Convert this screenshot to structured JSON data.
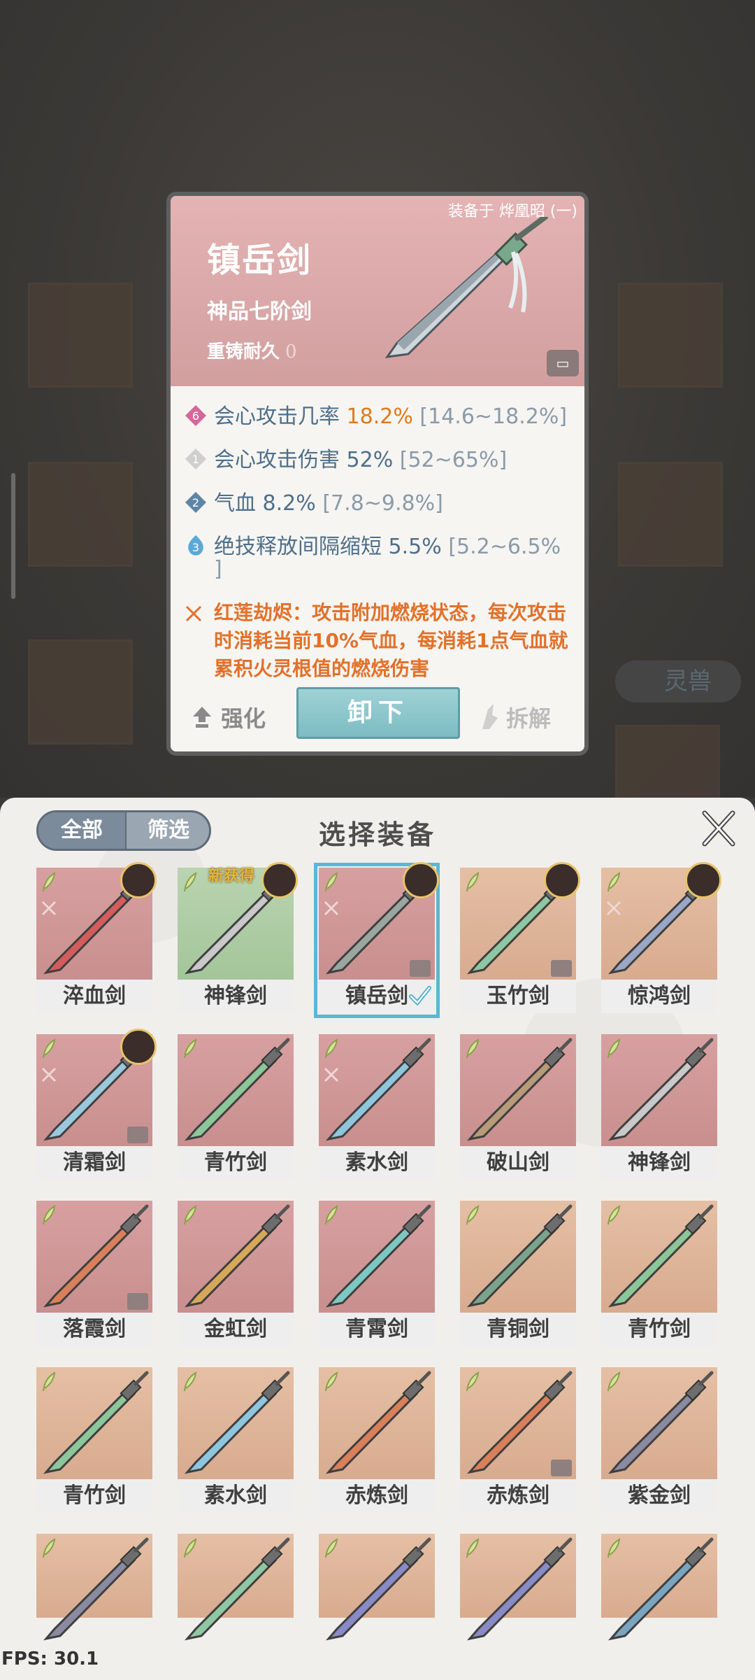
{
  "detail": {
    "equipped_on": "装备于 烨凰昭 (一)",
    "name": "镇岳剑",
    "grade": "神品七阶剑",
    "recast_label": "重铸耐久",
    "recast_value": "0",
    "stats": [
      {
        "badge": "6",
        "badge_color": "#d9669a",
        "label": "会心攻击几率",
        "value": "18.2%",
        "range": "[14.6~18.2%]"
      },
      {
        "badge": "1",
        "badge_color": "#cfcfcf",
        "label": "会心攻击伤害",
        "value": "52%",
        "range": "[52~65%]"
      },
      {
        "badge": "2",
        "badge_color": "#5f85a6",
        "label": "气血",
        "value": "8.2%",
        "range": "[7.8~9.8%]"
      },
      {
        "badge": "3",
        "badge_color": "#5aa9d8",
        "label": "绝技释放间隔缩短",
        "value": "5.5%",
        "range": "[5.2~6.5%"
      }
    ],
    "stat4_wrap": "]",
    "skill_text": "红莲劫烬：攻击附加燃烧状态，每次攻击时消耗当前10%气血，每消耗1点气血就累积火灵根值的燃烧伤害",
    "btn_strengthen": "强化",
    "btn_unequip": "卸下",
    "btn_dismantle": "拆解"
  },
  "background": {
    "chip_label": "灵兽"
  },
  "panel": {
    "seg_all": "全部",
    "seg_filter": "筛选",
    "title": "选择装备",
    "new_tag": "新获得"
  },
  "items": [
    {
      "name": "淬血剑",
      "bg": "red",
      "fire": true,
      "lock": false,
      "avatar": true,
      "new": false,
      "selected": false,
      "blade": "#d45c5c"
    },
    {
      "name": "神锋剑",
      "bg": "green",
      "fire": false,
      "lock": false,
      "avatar": true,
      "new": true,
      "selected": false,
      "blade": "#c9c9c9"
    },
    {
      "name": "镇岳剑",
      "bg": "red",
      "fire": true,
      "lock": true,
      "avatar": true,
      "new": false,
      "selected": true,
      "blade": "#9aa6a0"
    },
    {
      "name": "玉竹剑",
      "bg": "peach",
      "fire": false,
      "lock": true,
      "avatar": true,
      "new": false,
      "selected": false,
      "blade": "#8fc7a2"
    },
    {
      "name": "惊鸿剑",
      "bg": "peach",
      "fire": true,
      "lock": false,
      "avatar": true,
      "new": false,
      "selected": false,
      "blade": "#9aa7c6"
    },
    {
      "name": "清霜剑",
      "bg": "red",
      "fire": true,
      "lock": true,
      "avatar": true,
      "new": false,
      "selected": false,
      "blade": "#9bc8dc"
    },
    {
      "name": "青竹剑",
      "bg": "red",
      "fire": false,
      "lock": false,
      "avatar": false,
      "new": false,
      "selected": false,
      "blade": "#8cc79a"
    },
    {
      "name": "素水剑",
      "bg": "red",
      "fire": true,
      "lock": false,
      "avatar": false,
      "new": false,
      "selected": false,
      "blade": "#8fc6de"
    },
    {
      "name": "破山剑",
      "bg": "red",
      "fire": false,
      "lock": false,
      "avatar": false,
      "new": false,
      "selected": false,
      "blade": "#b79a78"
    },
    {
      "name": "神锋剑",
      "bg": "red",
      "fire": false,
      "lock": false,
      "avatar": false,
      "new": false,
      "selected": false,
      "blade": "#c9c9c9"
    },
    {
      "name": "落霞剑",
      "bg": "red",
      "fire": false,
      "lock": true,
      "avatar": false,
      "new": false,
      "selected": false,
      "blade": "#d9805a"
    },
    {
      "name": "金虹剑",
      "bg": "red",
      "fire": false,
      "lock": false,
      "avatar": false,
      "new": false,
      "selected": false,
      "blade": "#d6a85a"
    },
    {
      "name": "青霄剑",
      "bg": "red",
      "fire": false,
      "lock": false,
      "avatar": false,
      "new": false,
      "selected": false,
      "blade": "#7ec8c2"
    },
    {
      "name": "青铜剑",
      "bg": "peach",
      "fire": false,
      "lock": false,
      "avatar": false,
      "new": false,
      "selected": false,
      "blade": "#7aa58c"
    },
    {
      "name": "青竹剑",
      "bg": "peach",
      "fire": false,
      "lock": false,
      "avatar": false,
      "new": false,
      "selected": false,
      "blade": "#8cc79a"
    },
    {
      "name": "青竹剑",
      "bg": "peach",
      "fire": false,
      "lock": false,
      "avatar": false,
      "new": false,
      "selected": false,
      "blade": "#8cc79a"
    },
    {
      "name": "素水剑",
      "bg": "peach",
      "fire": false,
      "lock": false,
      "avatar": false,
      "new": false,
      "selected": false,
      "blade": "#8fc6de"
    },
    {
      "name": "赤炼剑",
      "bg": "peach",
      "fire": false,
      "lock": false,
      "avatar": false,
      "new": false,
      "selected": false,
      "blade": "#d9805a"
    },
    {
      "name": "赤炼剑",
      "bg": "peach",
      "fire": false,
      "lock": true,
      "avatar": false,
      "new": false,
      "selected": false,
      "blade": "#d9805a"
    },
    {
      "name": "紫金剑",
      "bg": "peach",
      "fire": false,
      "lock": false,
      "avatar": false,
      "new": false,
      "selected": false,
      "blade": "#8a8aa0"
    },
    {
      "name": "",
      "bg": "peach",
      "fire": false,
      "lock": false,
      "avatar": false,
      "new": false,
      "selected": false,
      "blade": "#8a8aa0"
    },
    {
      "name": "",
      "bg": "peach",
      "fire": false,
      "lock": false,
      "avatar": false,
      "new": false,
      "selected": false,
      "blade": "#8fc7a2"
    },
    {
      "name": "",
      "bg": "peach",
      "fire": false,
      "lock": false,
      "avatar": false,
      "new": false,
      "selected": false,
      "blade": "#8a8ac6"
    },
    {
      "name": "",
      "bg": "peach",
      "fire": false,
      "lock": false,
      "avatar": false,
      "new": false,
      "selected": false,
      "blade": "#8a8ac6"
    },
    {
      "name": "",
      "bg": "peach",
      "fire": false,
      "lock": false,
      "avatar": false,
      "new": false,
      "selected": false,
      "blade": "#7aa5c0"
    }
  ],
  "fps": "FPS: 30.1"
}
